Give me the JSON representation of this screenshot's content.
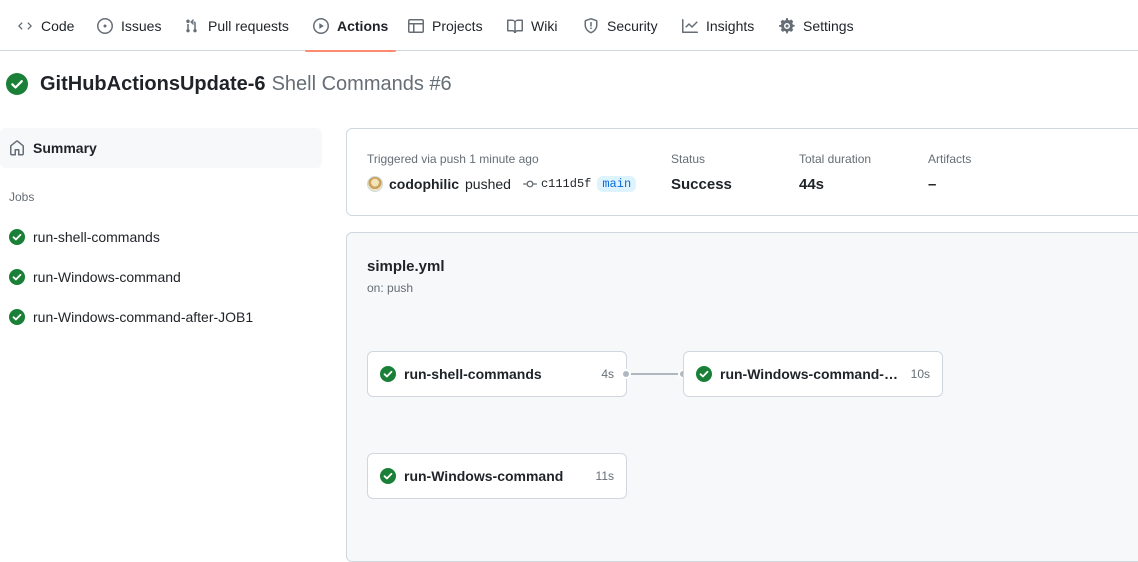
{
  "nav": {
    "tabs": [
      {
        "label": "Code",
        "icon": "code-icon"
      },
      {
        "label": "Issues",
        "icon": "issue-icon"
      },
      {
        "label": "Pull requests",
        "icon": "pull-request-icon"
      },
      {
        "label": "Actions",
        "icon": "play-icon",
        "active": true
      },
      {
        "label": "Projects",
        "icon": "table-icon"
      },
      {
        "label": "Wiki",
        "icon": "book-icon"
      },
      {
        "label": "Security",
        "icon": "shield-icon"
      },
      {
        "label": "Insights",
        "icon": "graph-icon"
      },
      {
        "label": "Settings",
        "icon": "gear-icon"
      }
    ]
  },
  "run": {
    "branch": "GitHubActionsUpdate-6",
    "name": "Shell Commands #6",
    "status_icon": "check-circle-icon"
  },
  "sidebar": {
    "summary_label": "Summary",
    "jobs_heading": "Jobs",
    "jobs": [
      {
        "label": "run-shell-commands",
        "status": "success"
      },
      {
        "label": "run-Windows-command",
        "status": "success"
      },
      {
        "label": "run-Windows-command-after-JOB1",
        "status": "success"
      }
    ]
  },
  "summary": {
    "trigger_text": "Triggered via push 1 minute ago",
    "user": "codophilic",
    "action": "pushed",
    "commit": "c111d5f",
    "branch": "main",
    "status_label": "Status",
    "status_value": "Success",
    "duration_label": "Total duration",
    "duration_value": "44s",
    "artifacts_label": "Artifacts",
    "artifacts_value": "–"
  },
  "workflow": {
    "file": "simple.yml",
    "trigger": "on: push",
    "nodes": [
      {
        "name": "run-shell-commands",
        "duration": "4s"
      },
      {
        "name": "run-Windows-command-after-JOB1",
        "duration": "10s"
      },
      {
        "name": "run-Windows-command",
        "duration": "11s"
      }
    ]
  },
  "colors": {
    "success": "#1a7f37",
    "active_tab_underline": "#fd8c73",
    "link": "#0969da"
  }
}
